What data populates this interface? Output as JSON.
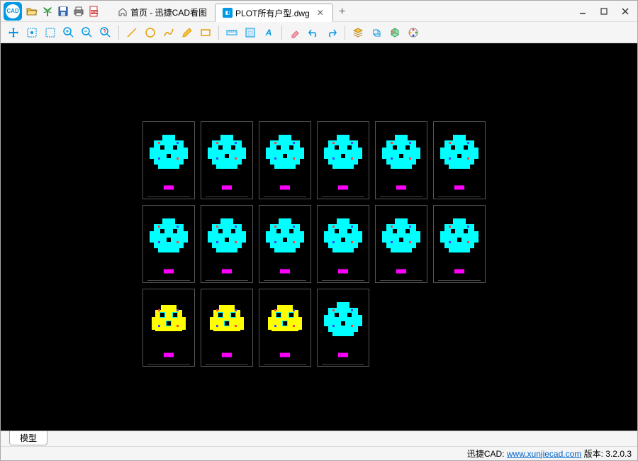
{
  "tabs": {
    "home": "首页 - 迅捷CAD看图",
    "file": "PLOT所有户型.dwg"
  },
  "footer": {
    "model_tab": "模型"
  },
  "status": {
    "brand": "迅捷CAD:",
    "url_text": "www.xunjiecad.com",
    "version_label": "版本:",
    "version": "3.2.0.3"
  },
  "icons": {
    "app": "CAD"
  }
}
